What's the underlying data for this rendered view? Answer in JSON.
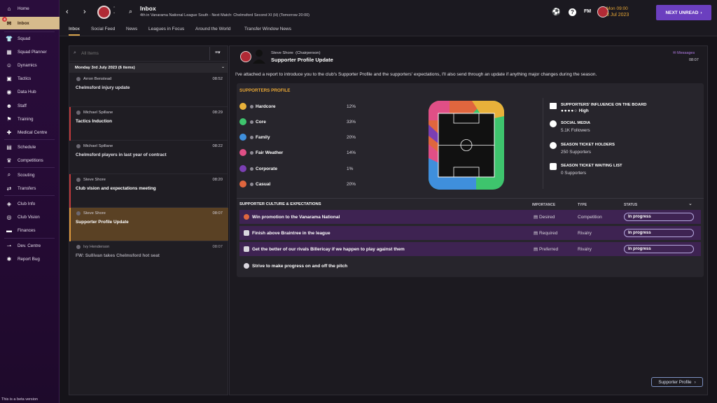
{
  "sidebar": {
    "items": [
      {
        "label": "Home",
        "icon": "home-icon"
      },
      {
        "label": "Inbox",
        "icon": "inbox-icon",
        "badge": "4"
      },
      {
        "label": "Squad",
        "icon": "shirt-icon"
      },
      {
        "label": "Squad Planner",
        "icon": "planner-icon"
      },
      {
        "label": "Dynamics",
        "icon": "dynamics-icon"
      },
      {
        "label": "Tactics",
        "icon": "tactics-icon"
      },
      {
        "label": "Data Hub",
        "icon": "data-hub-icon"
      },
      {
        "label": "Staff",
        "icon": "staff-icon"
      },
      {
        "label": "Training",
        "icon": "training-icon"
      },
      {
        "label": "Medical Centre",
        "icon": "medical-icon"
      },
      {
        "label": "Schedule",
        "icon": "schedule-icon"
      },
      {
        "label": "Competitions",
        "icon": "trophy-icon"
      },
      {
        "label": "Scouting",
        "icon": "scouting-icon"
      },
      {
        "label": "Transfers",
        "icon": "transfers-icon"
      },
      {
        "label": "Club Info",
        "icon": "club-info-icon"
      },
      {
        "label": "Club Vision",
        "icon": "club-vision-icon"
      },
      {
        "label": "Finances",
        "icon": "finances-icon"
      },
      {
        "label": "Dev. Centre",
        "icon": "dev-centre-icon"
      },
      {
        "label": "Report Bug",
        "icon": "bug-icon"
      }
    ],
    "beta_text": "This is a beta version"
  },
  "topbar": {
    "title": "Inbox",
    "subtitle": "4th in Vanarama National League South - Next Match: Chelmsford Second XI (H) (Tomorrow 20:00)",
    "fm_label": "FM",
    "time": "Mon 09:00",
    "date": "3 Jul 2023",
    "next_unread": "NEXT UNREAD"
  },
  "tabs": [
    "Inbox",
    "Social Feed",
    "News",
    "Leagues in Focus",
    "Around the World",
    "Transfer Window News"
  ],
  "left": {
    "search_placeholder": "All Items",
    "date_header": "Monday 3rd July 2023 (6 items)",
    "messages": [
      {
        "from": "Arron Benstead",
        "time": "08:52",
        "subject": "Chelmsford injury update"
      },
      {
        "from": "Michael Spillane",
        "time": "08:29",
        "subject": "Tactics Induction"
      },
      {
        "from": "Michael Spillane",
        "time": "08:22",
        "subject": "Chelmsford players in last year of contract"
      },
      {
        "from": "Steve Shore",
        "time": "08:20",
        "subject": "Club vision and expectations meeting"
      },
      {
        "from": "Steve Shore",
        "time": "08:07",
        "subject": "Supporter Profile Update"
      },
      {
        "from": "Ivy Henderson",
        "time": "08:07",
        "subject": "FW: Sullivan takes Chelmsford hot seat"
      }
    ]
  },
  "message": {
    "sender": "Steve Shore",
    "role": "(Chairperson)",
    "title": "Supporter Profile Update",
    "messages_link": "Messages",
    "time": "08:07",
    "body": "I've attached a report to introduce you to the club's Supporter Profile and the supporters' expectations, I'll also send through an update if anything major changes during the season."
  },
  "profile": {
    "heading": "SUPPORTERS PROFILE",
    "groups": [
      {
        "name": "Hardcore",
        "pct": "12%",
        "color": "#e8b13a"
      },
      {
        "name": "Core",
        "pct": "33%",
        "color": "#3ec46d"
      },
      {
        "name": "Family",
        "pct": "20%",
        "color": "#3f8fdc"
      },
      {
        "name": "Fair Weather",
        "pct": "14%",
        "color": "#e04f86"
      },
      {
        "name": "Corporate",
        "pct": "1%",
        "color": "#7b3fb3"
      },
      {
        "name": "Casual",
        "pct": "20%",
        "color": "#e0663e"
      }
    ],
    "influence_title": "SUPPORTERS' INFLUENCE ON THE BOARD",
    "influence_value": "High",
    "social_title": "SOCIAL MEDIA",
    "social_value": "5.1K Followers",
    "season_title": "SEASON TICKET HOLDERS",
    "season_value": "250 Supporters",
    "waiting_title": "SEASON TICKET WAITING LIST",
    "waiting_value": "0 Supporters"
  },
  "culture": {
    "heading": "SUPPORTER CULTURE & EXPECTATIONS",
    "col_importance": "IMPORTANCE",
    "col_type": "TYPE",
    "col_status": "STATUS",
    "rows": [
      {
        "text": "Win promotion to the Vanarama National",
        "importance": "Desired",
        "type": "Competition",
        "status": "In progress"
      },
      {
        "text": "Finish above Braintree in the league",
        "importance": "Required",
        "type": "Rivalry",
        "status": "In progress"
      },
      {
        "text": "Get the better of our rivals Billericay if we happen to play against them",
        "importance": "Preferred",
        "type": "Rivalry",
        "status": "In progress"
      },
      {
        "text": "Strive to make progress on and off the pitch",
        "importance": "",
        "type": "",
        "status": ""
      }
    ]
  },
  "footer_button": "Supporter Profile"
}
